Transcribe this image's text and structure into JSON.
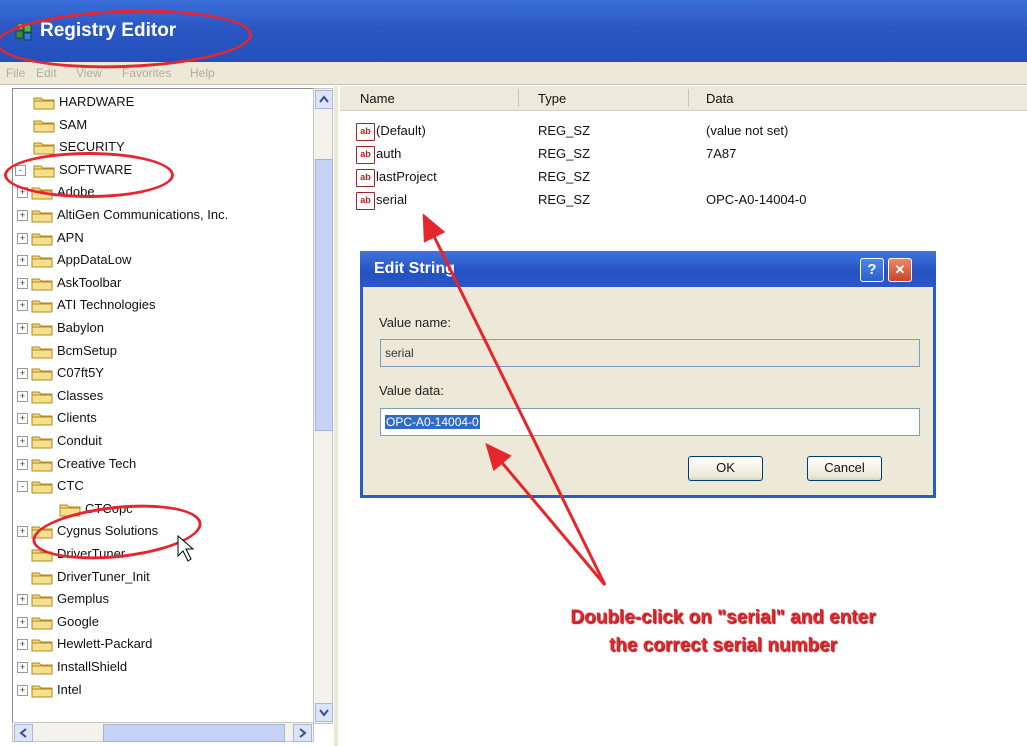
{
  "window": {
    "title": "Registry Editor"
  },
  "menu": [
    "File",
    "Edit",
    "View",
    "Favorites",
    "Help"
  ],
  "tree": [
    {
      "label": "HARDWARE",
      "expander": ""
    },
    {
      "label": "SAM",
      "expander": ""
    },
    {
      "label": "SECURITY",
      "expander": ""
    },
    {
      "label": "SOFTWARE",
      "expander": "-"
    },
    {
      "label": "Adobe",
      "expander": "+"
    },
    {
      "label": "AltiGen Communications, Inc.",
      "expander": "+"
    },
    {
      "label": "APN",
      "expander": "+"
    },
    {
      "label": "AppDataLow",
      "expander": "+"
    },
    {
      "label": "AskToolbar",
      "expander": "+"
    },
    {
      "label": "ATI Technologies",
      "expander": "+"
    },
    {
      "label": "Babylon",
      "expander": "+"
    },
    {
      "label": "BcmSetup",
      "expander": ""
    },
    {
      "label": "C07ft5Y",
      "expander": "+"
    },
    {
      "label": "Classes",
      "expander": "+"
    },
    {
      "label": "Clients",
      "expander": "+"
    },
    {
      "label": "Conduit",
      "expander": "+"
    },
    {
      "label": "Creative Tech",
      "expander": "+"
    },
    {
      "label": "CTC",
      "expander": "-"
    },
    {
      "label": "CTCopc",
      "expander": ""
    },
    {
      "label": "Cygnus Solutions",
      "expander": "+"
    },
    {
      "label": "DriverTuner",
      "expander": ""
    },
    {
      "label": "DriverTuner_Init",
      "expander": ""
    },
    {
      "label": "Gemplus",
      "expander": "+"
    },
    {
      "label": "Google",
      "expander": "+"
    },
    {
      "label": "Hewlett-Packard",
      "expander": "+"
    },
    {
      "label": "InstallShield",
      "expander": "+"
    },
    {
      "label": "Intel",
      "expander": "+"
    }
  ],
  "values": {
    "headers": {
      "name": "Name",
      "type": "Type",
      "data": "Data"
    },
    "rows": [
      {
        "name": "(Default)",
        "type": "REG_SZ",
        "data": "(value not set)",
        "icon": "ab"
      },
      {
        "name": "auth",
        "type": "REG_SZ",
        "data": "7A87",
        "icon": "ab"
      },
      {
        "name": "lastProject",
        "type": "REG_SZ",
        "data": "",
        "icon": "ab"
      },
      {
        "name": "serial",
        "type": "REG_SZ",
        "data": "OPC-A0-14004-0",
        "icon": "ab"
      }
    ]
  },
  "dialog": {
    "title": "Edit String",
    "help_glyph": "?",
    "close_glyph": "✕",
    "value_name_label": "Value name:",
    "value_name": "serial",
    "value_data_label": "Value data:",
    "value_data": "OPC-A0-14004-0",
    "ok_label": "OK",
    "cancel_label": "Cancel"
  },
  "annotation": {
    "line1": "Double-click on \"serial\" and enter",
    "line2": "the correct serial number",
    "color": "#e5262d"
  }
}
